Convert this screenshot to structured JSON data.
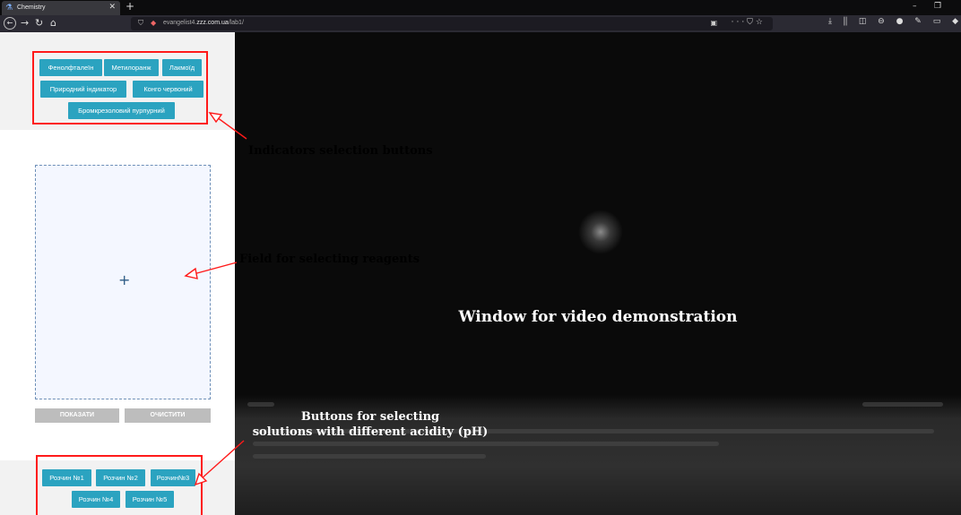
{
  "browser": {
    "tab_title": "Chemistry",
    "url_prefix": "evangelist4.",
    "url_domain": "zzz.com.ua",
    "url_path": "/lab1/",
    "tab_icon": "flask-icon",
    "colors": {
      "chrome_dark": "#0c0c0d",
      "toolbar": "#2b2a33"
    }
  },
  "indicators": {
    "buttons": [
      "Фенолфталеїн",
      "Метилоранж",
      "Лакмоїд",
      "Природний індикатор",
      "Конго червоний",
      "Бромкрезоловий пурпурний"
    ]
  },
  "reagent_field": {
    "plus": "+"
  },
  "actions": {
    "show": "ПОКАЗАТИ",
    "clear": "ОЧИСТИТИ"
  },
  "solutions": {
    "buttons": [
      "Розчин №1",
      "Розчин №2",
      "Розчин№3",
      "Розчин №4",
      "Розчин №5"
    ]
  },
  "annotations": {
    "indicators": "Indicators selection buttons",
    "reagents": "Field for selecting reagents",
    "video": "Window for video demonstration",
    "solutions_line1": "Buttons for selecting",
    "solutions_line2": "solutions with different acidity (pH)"
  },
  "colors": {
    "accent": "#2ba3c0",
    "annotation": "#ff1a1a",
    "gray_button": "#bdbdbd"
  }
}
